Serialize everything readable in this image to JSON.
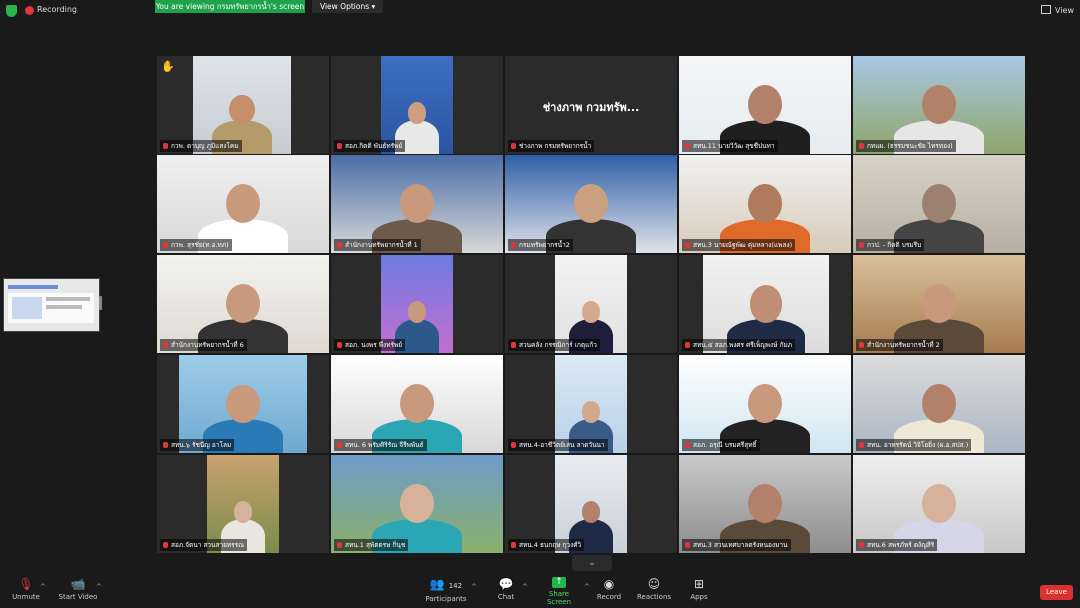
{
  "topbar": {
    "recording_label": "Recording",
    "viewing_text": "You are viewing กรมทรัพยากรน้ำ's screen",
    "view_options_label": "View Options ▾",
    "view_label": "View"
  },
  "gallery": {
    "tiles": [
      {
        "name": "กวพ. ดาบุญ ภูมิแสงโคม",
        "raised_hand": true
      },
      {
        "name": "สอภ.กิตติ พันธ์ทรัพย์"
      },
      {
        "name": "ช่างภาพ กรมทรัพยากรน้ำ",
        "big_label": "ช่างภาพ กวมทรัพ..."
      },
      {
        "name": "สทน.11 นายวิวัฒ สุขชีปนทา"
      },
      {
        "name": "กทแผ. (ธรรมชนะชัย  ไทรทอง)"
      },
      {
        "name": "กวพ. สุรชัย(ท.อ.ทภ)"
      },
      {
        "name": "สำนักงานทรัพยากรน้ำที่ 1"
      },
      {
        "name": "กรมทรัพยากรน้ำ2",
        "active": true
      },
      {
        "name": "สทน.3 นายณัฐพัฒ คุ่มหลาง(แพลง)"
      },
      {
        "name": "กวป. - กิตติ บรมรีบ"
      },
      {
        "name": "สำนักงานทรัพยากรน้ำที่ 6"
      },
      {
        "name": "สอภ. นงพร พึ่งทรัพย์"
      },
      {
        "name": "สวนคลัง กรรณิการ์ เกตุแก้ว"
      },
      {
        "name": "สทน.๕ สอภ.พงศร ศรีเพ็ญพงษ์ กัมภ"
      },
      {
        "name": "สำนักงานทรัพยากรน้ำที่ 2"
      },
      {
        "name": "สทน.๖ รัชนีญ อาโลม"
      },
      {
        "name": "สทน. 6 พรัมศิริรัณ จีรีพพันธ์"
      },
      {
        "name": "สทน.4-อาชีวิตย์เสน ลาดวันนา"
      },
      {
        "name": "สอภ. อรุณี บรมศรีสุทธิ์"
      },
      {
        "name": "สทน. อาทรรัตน์ วิจิโยยิ่ง (ผ.อ.สปส.)"
      },
      {
        "name": "สอภ.จัตนา สวนสายทรรณ"
      },
      {
        "name": "สทน.1 สุพัตตรษ กิ่นุช"
      },
      {
        "name": "สทน.4 ธนกฤษ กุวงศ์วิ"
      },
      {
        "name": "สทน.3 สวนเทศบาลตรังหนองมาน"
      },
      {
        "name": "สทน.6 สพรภัทร์ ดงัญสิริ"
      }
    ]
  },
  "toolbar": {
    "unmute_label": "Unmute",
    "start_video_label": "Start Video",
    "participants_label": "Participants",
    "participants_count": "142",
    "chat_label": "Chat",
    "share_label": "Share Screen",
    "record_label": "Record",
    "reactions_label": "Reactions",
    "apps_label": "Apps",
    "leave_label": "Leave"
  },
  "colors": {
    "background": "#1a1a1a",
    "tile": "#2b2b2b",
    "active_border": "#c8d44a",
    "share_green": "#22b74b",
    "leave_red": "#d9322f",
    "muted_red": "#e0363a"
  }
}
